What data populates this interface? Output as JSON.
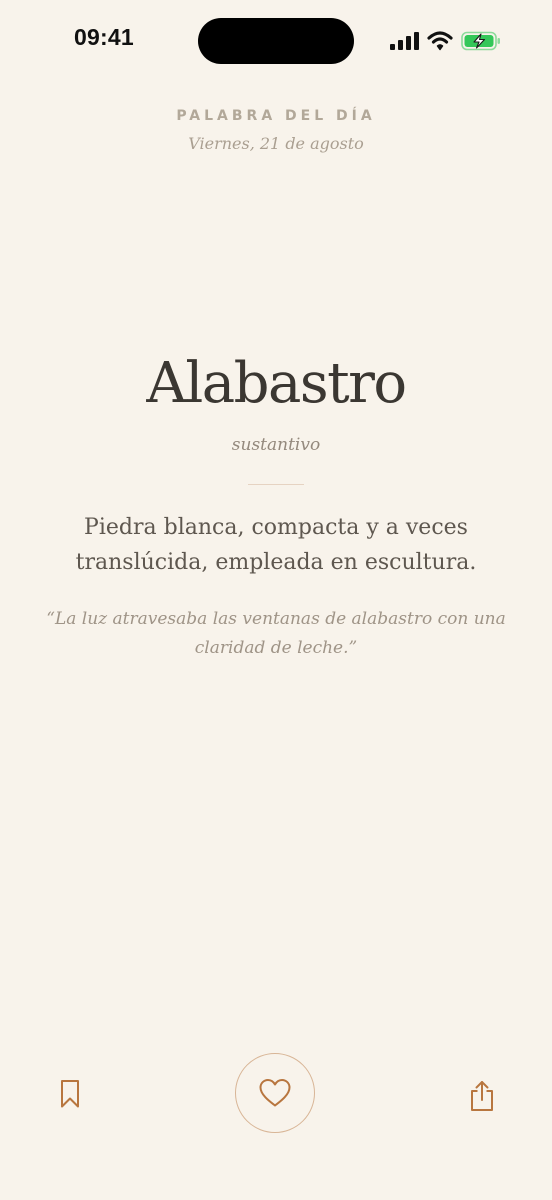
{
  "status_bar": {
    "time": "09:41",
    "icons": [
      "cellular-signal-icon",
      "wifi-icon",
      "battery-charging-icon"
    ]
  },
  "header": {
    "eyebrow": "PALABRA DEL DÍA",
    "date": "Viernes, 21 de agosto"
  },
  "entry": {
    "word": "Alabastro",
    "part_of_speech": "sustantivo",
    "definition": "Piedra blanca, compacta y a veces translúcida, empleada en escultura.",
    "example": "“La luz atravesaba las ventanas de alabastro con una claridad de leche.”"
  },
  "actions": {
    "bookmark_icon": "bookmark-icon",
    "like_icon": "heart-icon",
    "share_icon": "share-icon"
  },
  "colors": {
    "background": "#f8f3eb",
    "accent": "#b8763f",
    "battery": "#34c759"
  }
}
